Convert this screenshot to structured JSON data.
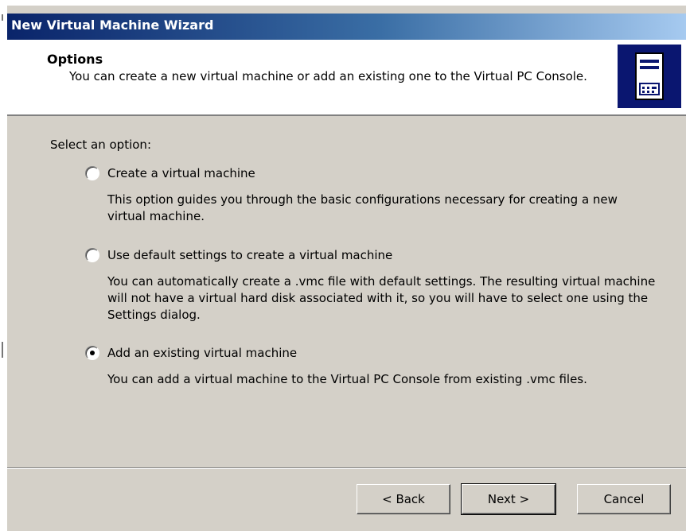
{
  "window": {
    "title": "New Virtual Machine Wizard"
  },
  "header": {
    "title": "Options",
    "subtitle": "You can create a new virtual machine or add an existing one to the Virtual PC Console.",
    "icon": "server-tower-icon"
  },
  "content": {
    "prompt": "Select an option:",
    "options": [
      {
        "label": "Create a virtual machine",
        "description": "This option guides you through the basic configurations necessary for creating a new virtual machine.",
        "selected": false
      },
      {
        "label": "Use default settings to create a virtual machine",
        "description": "You can automatically create a .vmc file with default settings. The resulting virtual machine will not have a virtual hard disk associated with it, so you will have to select one using the Settings dialog.",
        "selected": false
      },
      {
        "label": "Add an existing virtual machine",
        "description": "You can add a virtual machine to the Virtual PC Console from existing .vmc files.",
        "selected": true
      }
    ]
  },
  "buttons": {
    "back": "< Back",
    "next": "Next >",
    "cancel": "Cancel"
  },
  "colors": {
    "titlebar_start": "#0a246a",
    "titlebar_end": "#a6caf0",
    "dialog_bg": "#d4d0c8",
    "icon_bg": "#0a1670"
  }
}
